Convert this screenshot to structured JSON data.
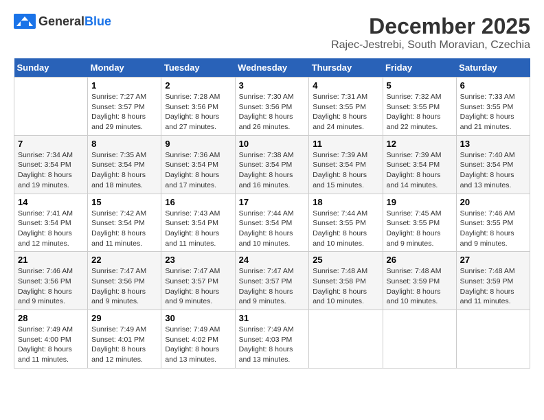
{
  "header": {
    "logo_general": "General",
    "logo_blue": "Blue",
    "month_title": "December 2025",
    "location": "Rajec-Jestrebi, South Moravian, Czechia"
  },
  "weekdays": [
    "Sunday",
    "Monday",
    "Tuesday",
    "Wednesday",
    "Thursday",
    "Friday",
    "Saturday"
  ],
  "weeks": [
    [
      {
        "day": "",
        "info": ""
      },
      {
        "day": "1",
        "info": "Sunrise: 7:27 AM\nSunset: 3:57 PM\nDaylight: 8 hours\nand 29 minutes."
      },
      {
        "day": "2",
        "info": "Sunrise: 7:28 AM\nSunset: 3:56 PM\nDaylight: 8 hours\nand 27 minutes."
      },
      {
        "day": "3",
        "info": "Sunrise: 7:30 AM\nSunset: 3:56 PM\nDaylight: 8 hours\nand 26 minutes."
      },
      {
        "day": "4",
        "info": "Sunrise: 7:31 AM\nSunset: 3:55 PM\nDaylight: 8 hours\nand 24 minutes."
      },
      {
        "day": "5",
        "info": "Sunrise: 7:32 AM\nSunset: 3:55 PM\nDaylight: 8 hours\nand 22 minutes."
      },
      {
        "day": "6",
        "info": "Sunrise: 7:33 AM\nSunset: 3:55 PM\nDaylight: 8 hours\nand 21 minutes."
      }
    ],
    [
      {
        "day": "7",
        "info": "Sunrise: 7:34 AM\nSunset: 3:54 PM\nDaylight: 8 hours\nand 19 minutes."
      },
      {
        "day": "8",
        "info": "Sunrise: 7:35 AM\nSunset: 3:54 PM\nDaylight: 8 hours\nand 18 minutes."
      },
      {
        "day": "9",
        "info": "Sunrise: 7:36 AM\nSunset: 3:54 PM\nDaylight: 8 hours\nand 17 minutes."
      },
      {
        "day": "10",
        "info": "Sunrise: 7:38 AM\nSunset: 3:54 PM\nDaylight: 8 hours\nand 16 minutes."
      },
      {
        "day": "11",
        "info": "Sunrise: 7:39 AM\nSunset: 3:54 PM\nDaylight: 8 hours\nand 15 minutes."
      },
      {
        "day": "12",
        "info": "Sunrise: 7:39 AM\nSunset: 3:54 PM\nDaylight: 8 hours\nand 14 minutes."
      },
      {
        "day": "13",
        "info": "Sunrise: 7:40 AM\nSunset: 3:54 PM\nDaylight: 8 hours\nand 13 minutes."
      }
    ],
    [
      {
        "day": "14",
        "info": "Sunrise: 7:41 AM\nSunset: 3:54 PM\nDaylight: 8 hours\nand 12 minutes."
      },
      {
        "day": "15",
        "info": "Sunrise: 7:42 AM\nSunset: 3:54 PM\nDaylight: 8 hours\nand 11 minutes."
      },
      {
        "day": "16",
        "info": "Sunrise: 7:43 AM\nSunset: 3:54 PM\nDaylight: 8 hours\nand 11 minutes."
      },
      {
        "day": "17",
        "info": "Sunrise: 7:44 AM\nSunset: 3:54 PM\nDaylight: 8 hours\nand 10 minutes."
      },
      {
        "day": "18",
        "info": "Sunrise: 7:44 AM\nSunset: 3:55 PM\nDaylight: 8 hours\nand 10 minutes."
      },
      {
        "day": "19",
        "info": "Sunrise: 7:45 AM\nSunset: 3:55 PM\nDaylight: 8 hours\nand 9 minutes."
      },
      {
        "day": "20",
        "info": "Sunrise: 7:46 AM\nSunset: 3:55 PM\nDaylight: 8 hours\nand 9 minutes."
      }
    ],
    [
      {
        "day": "21",
        "info": "Sunrise: 7:46 AM\nSunset: 3:56 PM\nDaylight: 8 hours\nand 9 minutes."
      },
      {
        "day": "22",
        "info": "Sunrise: 7:47 AM\nSunset: 3:56 PM\nDaylight: 8 hours\nand 9 minutes."
      },
      {
        "day": "23",
        "info": "Sunrise: 7:47 AM\nSunset: 3:57 PM\nDaylight: 8 hours\nand 9 minutes."
      },
      {
        "day": "24",
        "info": "Sunrise: 7:47 AM\nSunset: 3:57 PM\nDaylight: 8 hours\nand 9 minutes."
      },
      {
        "day": "25",
        "info": "Sunrise: 7:48 AM\nSunset: 3:58 PM\nDaylight: 8 hours\nand 10 minutes."
      },
      {
        "day": "26",
        "info": "Sunrise: 7:48 AM\nSunset: 3:59 PM\nDaylight: 8 hours\nand 10 minutes."
      },
      {
        "day": "27",
        "info": "Sunrise: 7:48 AM\nSunset: 3:59 PM\nDaylight: 8 hours\nand 11 minutes."
      }
    ],
    [
      {
        "day": "28",
        "info": "Sunrise: 7:49 AM\nSunset: 4:00 PM\nDaylight: 8 hours\nand 11 minutes."
      },
      {
        "day": "29",
        "info": "Sunrise: 7:49 AM\nSunset: 4:01 PM\nDaylight: 8 hours\nand 12 minutes."
      },
      {
        "day": "30",
        "info": "Sunrise: 7:49 AM\nSunset: 4:02 PM\nDaylight: 8 hours\nand 13 minutes."
      },
      {
        "day": "31",
        "info": "Sunrise: 7:49 AM\nSunset: 4:03 PM\nDaylight: 8 hours\nand 13 minutes."
      },
      {
        "day": "",
        "info": ""
      },
      {
        "day": "",
        "info": ""
      },
      {
        "day": "",
        "info": ""
      }
    ]
  ]
}
